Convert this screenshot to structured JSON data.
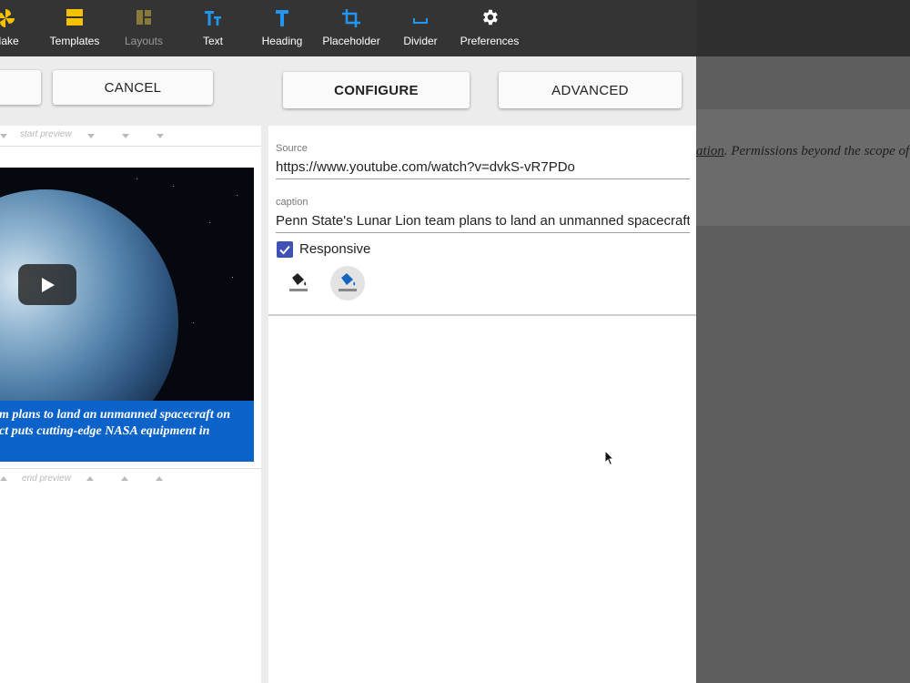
{
  "toolbar": {
    "items": [
      {
        "label": "Make",
        "icon": "pinwheel-icon",
        "color": "#f7c100"
      },
      {
        "label": "Templates",
        "icon": "templates-icon",
        "color": "#f7c100"
      },
      {
        "label": "Layouts",
        "icon": "layouts-icon",
        "color": "#8a7a3a",
        "disabled": true
      },
      {
        "label": "Text",
        "icon": "text-size-icon",
        "color": "#2196f3"
      },
      {
        "label": "Heading",
        "icon": "heading-icon",
        "color": "#2196f3"
      },
      {
        "label": "Placeholder",
        "icon": "crop-icon",
        "color": "#2196f3"
      },
      {
        "label": "Divider",
        "icon": "divider-icon",
        "color": "#2196f3"
      },
      {
        "label": "Preferences",
        "icon": "gear-icon",
        "color": "#ffffff"
      }
    ]
  },
  "buttons": {
    "cancel": "CANCEL",
    "configure": "CONFIGURE",
    "advanced": "ADVANCED"
  },
  "preview": {
    "start_label": "start preview",
    "end_label": "end preview",
    "caption_line1": "m plans to land an unmanned spacecraft on",
    "caption_line2": "ct puts cutting-edge NASA equipment in",
    "caption_bg": "#0b63c9"
  },
  "form": {
    "source_label": "Source",
    "source_value": "https://www.youtube.com/watch?v=dvkS-vR7PDo",
    "caption_label": "caption",
    "caption_value": "Penn State's Lunar Lion team plans to land an unmanned spacecraft on the moon",
    "responsive_label": "Responsive",
    "responsive_checked": true,
    "checkbox_color": "#3f51b5"
  },
  "background_doc": {
    "link_text": "ation",
    "text": ". Permissions beyond the scope of t"
  },
  "colors": {
    "toolbar_bg": "#343434",
    "accent_blue": "#2196f3",
    "accent_yellow": "#f7c100"
  }
}
